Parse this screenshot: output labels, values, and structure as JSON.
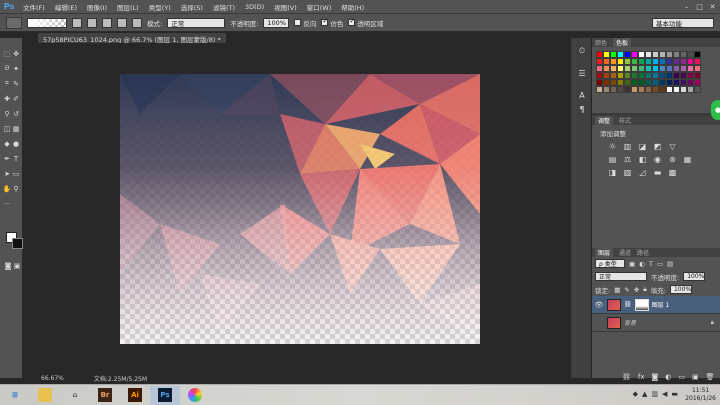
{
  "app": {
    "logo": "Ps"
  },
  "menubar": {
    "items": [
      "文件(F)",
      "编辑(E)",
      "图像(I)",
      "图层(L)",
      "类型(Y)",
      "选择(S)",
      "滤镜(T)",
      "3D(D)",
      "视图(V)",
      "窗口(W)",
      "帮助(H)"
    ],
    "win_buttons": [
      "–",
      "□",
      "✕"
    ]
  },
  "options": {
    "mode_label": "模式:",
    "mode_value": "正常",
    "opacity_label": "不透明度:",
    "opacity_value": "100%",
    "reverse_label": "反向",
    "dither_label": "仿色",
    "transparency_label": "透明区域",
    "workspace": "基本功能"
  },
  "document": {
    "tab_title": "57p58PICU63_1024.png @ 66.7% (图层 1, 图层蒙版/8) *",
    "zoom": "66.67%",
    "doc_info": "文档:2.25M/5.25M"
  },
  "panels": {
    "swatch_tabs": [
      "颜色",
      "色板"
    ],
    "adjust_tabs": [
      "调整",
      "样式"
    ],
    "adjust_title": "添加调整",
    "layer_tabs": [
      "图层",
      "通道",
      "路径"
    ],
    "filter_kind": "ρ 类型",
    "blend_mode": "正常",
    "opacity_label": "不透明度:",
    "opacity_value": "100%",
    "lock_label": "锁定:",
    "fill_label": "填充:",
    "fill_value": "100%",
    "layers": [
      {
        "name": "图层 1",
        "selected": true
      },
      {
        "name": "背景",
        "selected": false
      }
    ]
  },
  "taskbar": {
    "apps": [
      "Br",
      "Ai",
      "Ps"
    ],
    "time": "11:51",
    "date": "2016/1/26"
  },
  "colors": {
    "swatch_row1": [
      "#ff0000",
      "#ffff00",
      "#00ff00",
      "#00ffff",
      "#0000ff",
      "#ff00ff",
      "#ffffff",
      "#e6e6e6",
      "#cccccc",
      "#b3b3b3",
      "#999999",
      "#808080",
      "#666666",
      "#4d4d4d",
      "#000000"
    ],
    "swatch_row2": [
      "#ed1c24",
      "#f26522",
      "#f7941d",
      "#fff200",
      "#8dc63f",
      "#39b54a",
      "#00a651",
      "#00a99d",
      "#00aeef",
      "#0072bc",
      "#2e3192",
      "#662d91",
      "#92278f",
      "#ec008c",
      "#ed145b"
    ],
    "swatch_row3": [
      "#f26d7d",
      "#f68e56",
      "#fbaf5d",
      "#fff568",
      "#acd373",
      "#7cc576",
      "#3cb878",
      "#1cbbb4",
      "#00bff3",
      "#448ccb",
      "#5674b9",
      "#8560a8",
      "#a864a8",
      "#f06eaa",
      "#f26c7d"
    ],
    "swatch_row4": [
      "#9e0b0f",
      "#a0410d",
      "#a36209",
      "#aba000",
      "#598527",
      "#1a7b30",
      "#007236",
      "#00746b",
      "#0076a3",
      "#004a80",
      "#003471",
      "#32004b",
      "#4b0049",
      "#7b0046",
      "#7a0026"
    ],
    "swatch_row5": [
      "#790000",
      "#7b2e00",
      "#7d4900",
      "#827b00",
      "#406618",
      "#005e20",
      "#005826",
      "#005952",
      "#005b7f",
      "#003663",
      "#002157",
      "#1b1464",
      "#440e62",
      "#630460",
      "#9e005d"
    ],
    "swatch_row6": [
      "#c7b299",
      "#998675",
      "#736357",
      "#534741",
      "#37302d",
      "#c69c6d",
      "#a67c52",
      "#8c6239",
      "#754c24",
      "#603913",
      "#ffffff",
      "#f2f2f2",
      "#d9d9d9",
      "#a6a6a6",
      "#595959"
    ]
  }
}
